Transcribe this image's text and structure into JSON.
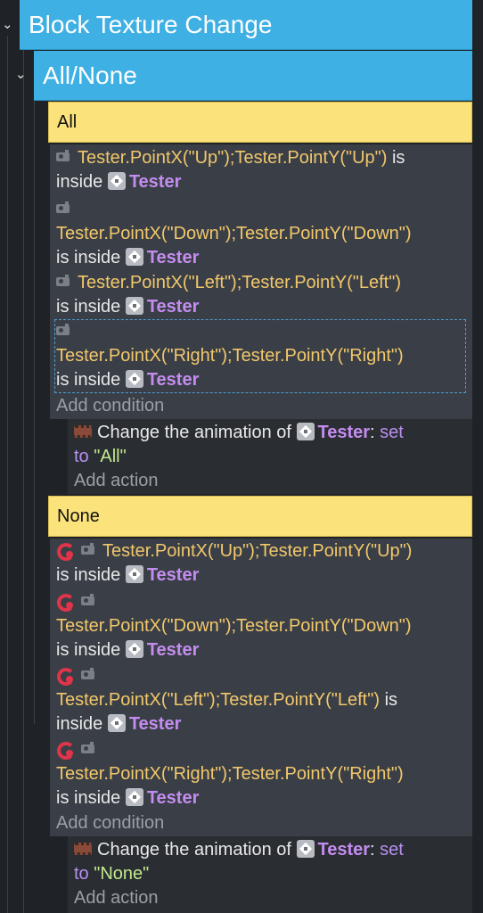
{
  "group": {
    "title": "Block Texture Change"
  },
  "subgroup": {
    "title": "All/None"
  },
  "events": [
    {
      "name": "All",
      "conditions": [
        {
          "expr": "Tester.PointX(\"Up\");Tester.PointY(\"Up\")",
          "text": "is",
          "text2": "inside",
          "object": "Tester"
        },
        {
          "expr": "Tester.PointX(\"Down\");Tester.PointY(\"Down\")",
          "text": "is inside",
          "object": "Tester"
        },
        {
          "expr": "Tester.PointX(\"Left\");Tester.PointY(\"Left\")",
          "text": "is inside",
          "object": "Tester"
        },
        {
          "expr": "Tester.PointX(\"Right\");Tester.PointY(\"Right\")",
          "text": "is inside",
          "object": "Tester"
        }
      ],
      "add_condition": "Add condition",
      "action": {
        "prefix": "Change the animation of",
        "object": "Tester",
        "colon": ":",
        "set": "set",
        "to": "to",
        "value": "\"All\""
      },
      "add_action": "Add action"
    },
    {
      "name": "None",
      "conditions": [
        {
          "expr": "Tester.PointX(\"Up\");Tester.PointY(\"Up\")",
          "text": "is inside",
          "object": "Tester"
        },
        {
          "expr": "Tester.PointX(\"Down\");Tester.PointY(\"Down\")",
          "text": "is inside",
          "object": "Tester"
        },
        {
          "expr": "Tester.PointX(\"Left\");Tester.PointY(\"Left\")",
          "text": "is",
          "text2": "inside",
          "object": "Tester"
        },
        {
          "expr": "Tester.PointX(\"Right\");Tester.PointY(\"Right\")",
          "text": "is inside",
          "object": "Tester"
        }
      ],
      "add_condition": "Add condition",
      "action": {
        "prefix": "Change the animation of",
        "object": "Tester",
        "colon": ":",
        "set": "set",
        "to": "to",
        "value": "\"None\""
      },
      "add_action": "Add action"
    }
  ],
  "icons": {
    "condition": "camera-icon",
    "object": "sprite-object-icon",
    "invert": "invert-condition-icon",
    "action": "film-strip-icon",
    "collapse": "chevron-down-icon"
  },
  "colors": {
    "group_header": "#3fb0e4",
    "event_header": "#fbe27a",
    "expression": "#f2c76b",
    "object_name": "#c58cf0",
    "string_value": "#c3e88d"
  }
}
